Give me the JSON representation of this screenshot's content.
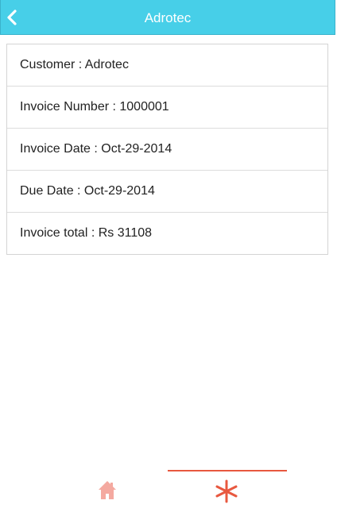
{
  "header": {
    "title": "Adrotec",
    "background_color": "#47cfe8"
  },
  "details": [
    {
      "label": "Customer",
      "value": "Adrotec",
      "text": "Customer : Adrotec"
    },
    {
      "label": "Invoice Number",
      "value": "1000001",
      "text": "Invoice Number : 1000001"
    },
    {
      "label": "Invoice Date",
      "value": "Oct-29-2014",
      "text": "Invoice Date : Oct-29-2014"
    },
    {
      "label": "Due Date",
      "value": "Oct-29-2014",
      "text": "Due Date : Oct-29-2014"
    },
    {
      "label": "Invoice total",
      "value": "Rs 31108",
      "text": "Invoice total : Rs 31108"
    }
  ],
  "tabbar": {
    "tabs": [
      {
        "icon": "home-icon",
        "active": false,
        "color": "#f4a9a0"
      },
      {
        "icon": "asterisk-icon",
        "active": true,
        "color": "#e8583f"
      }
    ]
  }
}
